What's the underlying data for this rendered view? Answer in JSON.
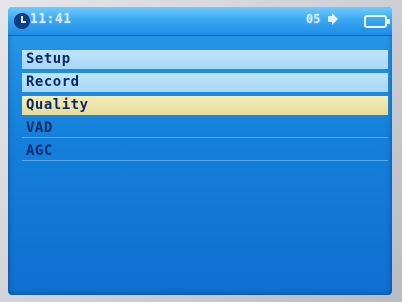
{
  "status_bar": {
    "time": "11:41",
    "volume": "05",
    "icons": [
      "clock-icon",
      "speaker-icon",
      "battery-icon"
    ]
  },
  "menu": {
    "items": [
      {
        "label": "Setup",
        "state": "highlighted"
      },
      {
        "label": "Record",
        "state": "highlighted"
      },
      {
        "label": "Quality",
        "state": "selected"
      },
      {
        "label": "VAD",
        "state": "normal"
      },
      {
        "label": "AGC",
        "state": "normal"
      }
    ]
  },
  "colors": {
    "screen_background": "#1580db",
    "highlight_row": "#a8d8f6",
    "selected_row": "#e6dc98",
    "menu_text": "#082a6a"
  }
}
